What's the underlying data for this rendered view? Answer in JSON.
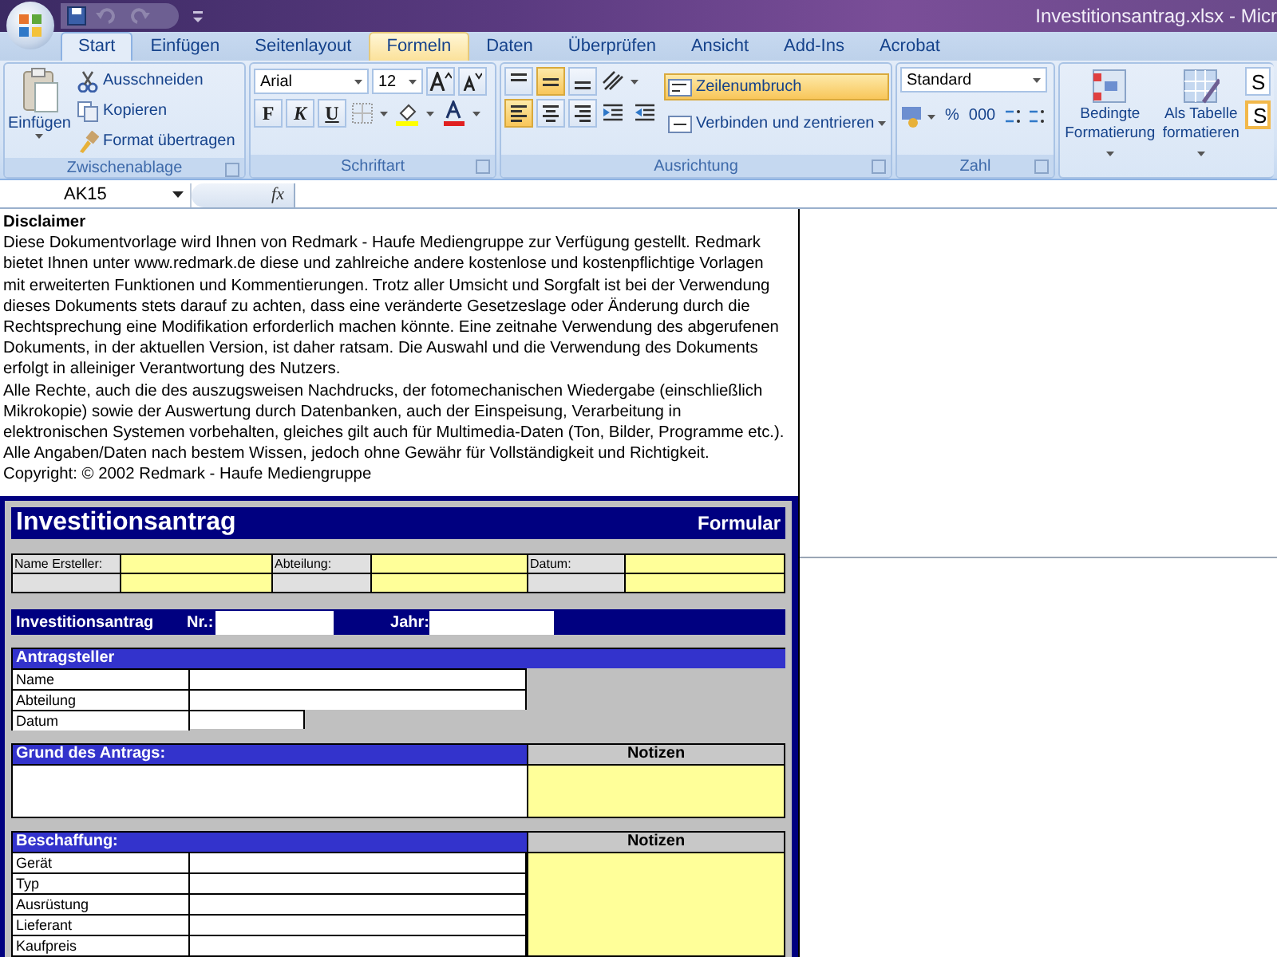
{
  "title_bar": {
    "title": "Investitionsantrag.xlsx - Micr"
  },
  "tabs": [
    {
      "label": "Start",
      "selected": true,
      "hover": false
    },
    {
      "label": "Einfügen",
      "selected": false,
      "hover": false
    },
    {
      "label": "Seitenlayout",
      "selected": false,
      "hover": false
    },
    {
      "label": "Formeln",
      "selected": false,
      "hover": true
    },
    {
      "label": "Daten",
      "selected": false,
      "hover": false
    },
    {
      "label": "Überprüfen",
      "selected": false,
      "hover": false
    },
    {
      "label": "Ansicht",
      "selected": false,
      "hover": false
    },
    {
      "label": "Add-Ins",
      "selected": false,
      "hover": false
    },
    {
      "label": "Acrobat",
      "selected": false,
      "hover": false
    }
  ],
  "ribbon": {
    "clipboard": {
      "label": "Zwischenablage",
      "paste": "Einfügen",
      "items": [
        "Ausschneiden",
        "Kopieren",
        "Format übertragen"
      ]
    },
    "font": {
      "label": "Schriftart",
      "font_name": "Arial",
      "font_size": "12",
      "styles": [
        "F",
        "K",
        "U"
      ]
    },
    "alignment": {
      "label": "Ausrichtung",
      "vertical": [
        {
          "kind": "top",
          "pressed": false
        },
        {
          "kind": "middle",
          "pressed": true
        },
        {
          "kind": "bottom",
          "pressed": false
        }
      ],
      "horizontal": [
        {
          "kind": "left",
          "pressed": true
        },
        {
          "kind": "center",
          "pressed": false
        },
        {
          "kind": "right",
          "pressed": false
        }
      ],
      "wrap": {
        "label": "Zeilenumbruch",
        "pressed": true
      },
      "merge": "Verbinden und zentrieren"
    },
    "number": {
      "label": "Zahl",
      "format": "Standard",
      "symbols": [
        "%",
        "000"
      ]
    },
    "styles": {
      "buttons": [
        {
          "line1": "Bedingte",
          "line2": "Formatierung"
        },
        {
          "line1": "Als Tabelle",
          "line2": "formatieren"
        }
      ],
      "cells": [
        "S",
        "S"
      ]
    }
  },
  "formula_bar": {
    "name_box": "AK15",
    "fx": "fx"
  },
  "sheet": {
    "disclaimer": {
      "heading": "Disclaimer",
      "lines": [
        "Diese Dokumentvorlage wird Ihnen von Redmark - Haufe Mediengruppe zur Verfügung gestellt. Redmark",
        "bietet Ihnen unter www.redmark.de diese und zahlreiche andere kostenlose und kostenpflichtige Vorlagen",
        "mit erweiterten Funktionen und Kommentierungen. Trotz aller Umsicht und Sorgfalt ist bei der Verwendung",
        "dieses Dokuments stets darauf zu achten, dass eine veränderte Gesetzeslage oder Änderung durch die",
        "Rechtsprechung eine Modifikation erforderlich machen könnte. Eine zeitnahe Verwendung des abgerufenen",
        "Dokuments, in der aktuellen Version, ist daher ratsam. Die Auswahl und die Verwendung des Dokuments",
        "erfolgt in alleiniger Verantwortung des Nutzers.",
        "Alle Rechte, auch die des auszugsweisen Nachdrucks, der fotomechanischen Wiedergabe (einschließlich",
        "Mikrokopie) sowie der Auswertung durch Datenbanken, auch der Einspeisung, Verarbeitung in",
        "elektronischen Systemen vorbehalten, gleiches gilt auch für Multimedia-Daten (Ton, Bilder, Programme etc.).",
        "Alle Angaben/Daten nach bestem Wissen, jedoch ohne Gewähr für Vollständigkeit und Richtigkeit.",
        "Copyright: © 2002 Redmark - Haufe Mediengruppe"
      ]
    },
    "form": {
      "title": "Investitionsantrag",
      "subtitle": "Formular",
      "header_labels": [
        "Name Ersteller:",
        "Abteilung:",
        "Datum:"
      ],
      "number_bar": {
        "label": "Investitionsantrag",
        "nr": "Nr.:",
        "year": "Jahr:"
      },
      "sections": [
        {
          "kind": "fields",
          "title": "Antragsteller",
          "rows": [
            {
              "label": "Name",
              "kind": "long"
            },
            {
              "label": "Abteilung",
              "kind": "long"
            },
            {
              "label": "Datum",
              "kind": "short"
            }
          ]
        },
        {
          "kind": "text",
          "title": "Grund des Antrags:",
          "notes": "Notizen"
        },
        {
          "kind": "fields",
          "title": "Beschaffung:",
          "notes": "Notizen",
          "rows": [
            {
              "label": "Gerät",
              "kind": "long"
            },
            {
              "label": "Typ",
              "kind": "long"
            },
            {
              "label": "Ausrüstung",
              "kind": "long"
            },
            {
              "label": "Lieferant",
              "kind": "long"
            },
            {
              "label": "Kaufpreis",
              "kind": "long"
            }
          ]
        }
      ]
    }
  }
}
